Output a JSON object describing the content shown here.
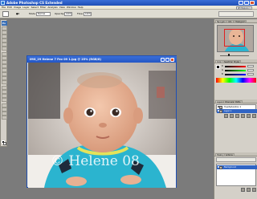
{
  "app": {
    "title": "Adobe Photoshop CS Extended",
    "icon": "photoshop-icon",
    "window_controls": [
      "minimize-icon",
      "maximize-icon",
      "close-icon"
    ]
  },
  "menu": {
    "items": [
      "File",
      "Edit",
      "Image",
      "Layer",
      "Select",
      "Filter",
      "Analysis",
      "View",
      "Window",
      "Help"
    ],
    "workspace": "Workspace ▾"
  },
  "options": {
    "mode_label": "Mode",
    "mode_value": "Normal",
    "opacity_label": "Opacity:",
    "opacity_value": "100%",
    "flow_label": "Flow:",
    "flow_value": "100%"
  },
  "document": {
    "title": "IMG_29 Helene 7 Fev 09 1.jpg @ 25% (RGB/8)",
    "zoom_level": "25%",
    "watermark": "© Helene 08"
  },
  "panels": {
    "navigator_tabs": [
      "Navigator",
      "Info",
      "Histogram"
    ],
    "color_tabs": [
      "Color",
      "Swatches",
      "Styles"
    ],
    "color_channels": [
      "R",
      "G",
      "B"
    ],
    "layers_tabs": [
      "Layers",
      "Channels",
      "Paths"
    ],
    "adjust_tabs": [
      "History",
      "Actions"
    ],
    "layer_name_top": "Hue/Saturation 1",
    "layer_name_selected": "Layer 1",
    "layer_name_bottom": "Background"
  },
  "colors": {
    "title_blue": "#2456c5",
    "workspace_gray": "#7b7b7b",
    "panel_gray": "#d4d0c8",
    "selected_layer": "#3165c4",
    "watermark": "#ffffff"
  }
}
